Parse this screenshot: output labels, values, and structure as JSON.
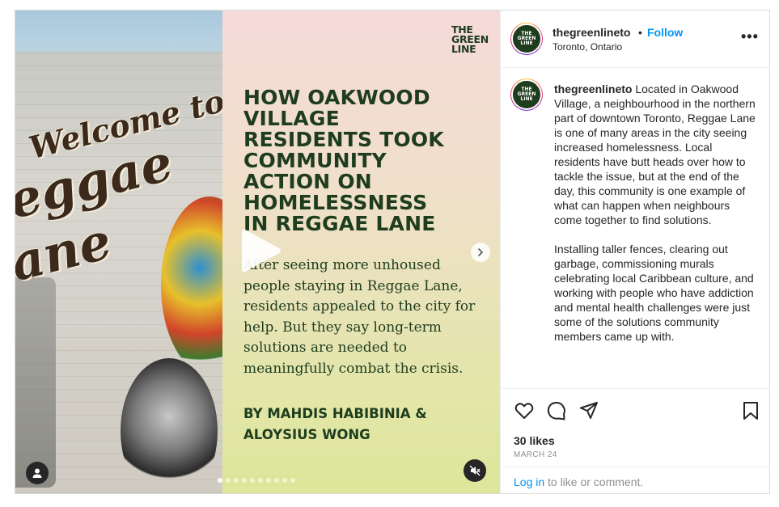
{
  "post": {
    "media": {
      "mural_words": [
        "Welcome to",
        "eggae",
        "ane"
      ],
      "brand_lines": [
        "THE",
        "GREEN",
        "LINE"
      ],
      "headline_lines": [
        "HOW OAKWOOD",
        "VILLAGE",
        "RESIDENTS TOOK",
        "COMMUNITY",
        "ACTION ON",
        "HOMELESSNESS",
        "IN REGGAE LANE"
      ],
      "standfirst": "After seeing more unhoused people staying in Reggae Lane, residents appealed to the city for help. But they say long-term solutions are needed to meaningfully combat the crisis.",
      "byline_lines": [
        "BY MAHDIS HABIBINIA &",
        "ALOYSIUS WONG"
      ],
      "carousel": {
        "total": 10,
        "current": 1
      }
    },
    "header": {
      "username": "thegreenlineto",
      "separator": "•",
      "follow_label": "Follow",
      "location": "Toronto, Ontario",
      "more_label": "•••"
    },
    "caption": {
      "username": "thegreenlineto",
      "paragraph1": "Located in Oakwood Village, a neighbourhood in the northern part of downtown Toronto, Reggae Lane is one of many areas in the city seeing increased homelessness. Local residents have butt heads over how to tackle the issue, but at the end of the day, this community is one example of what can happen when neighbours come together to find solutions.",
      "paragraph2": "Installing taller fences, clearing out garbage, commissioning murals celebrating local Caribbean culture, and working with people who have addiction and mental health challenges were just some of the solutions community members came up with."
    },
    "stats": {
      "likes": "30 likes",
      "date": "MARCH 24"
    },
    "footer": {
      "login_label": "Log in",
      "login_rest": "to like or comment."
    },
    "icons": [
      "play-icon",
      "chevron-right-icon",
      "user-tag-icon",
      "mute-icon",
      "heart-icon",
      "comment-icon",
      "share-icon",
      "bookmark-icon",
      "more-icon"
    ],
    "colors": {
      "brand_green": "#1e3d1e",
      "link_blue": "#0095f6",
      "text": "#262626",
      "muted": "#8e8e8e"
    }
  }
}
